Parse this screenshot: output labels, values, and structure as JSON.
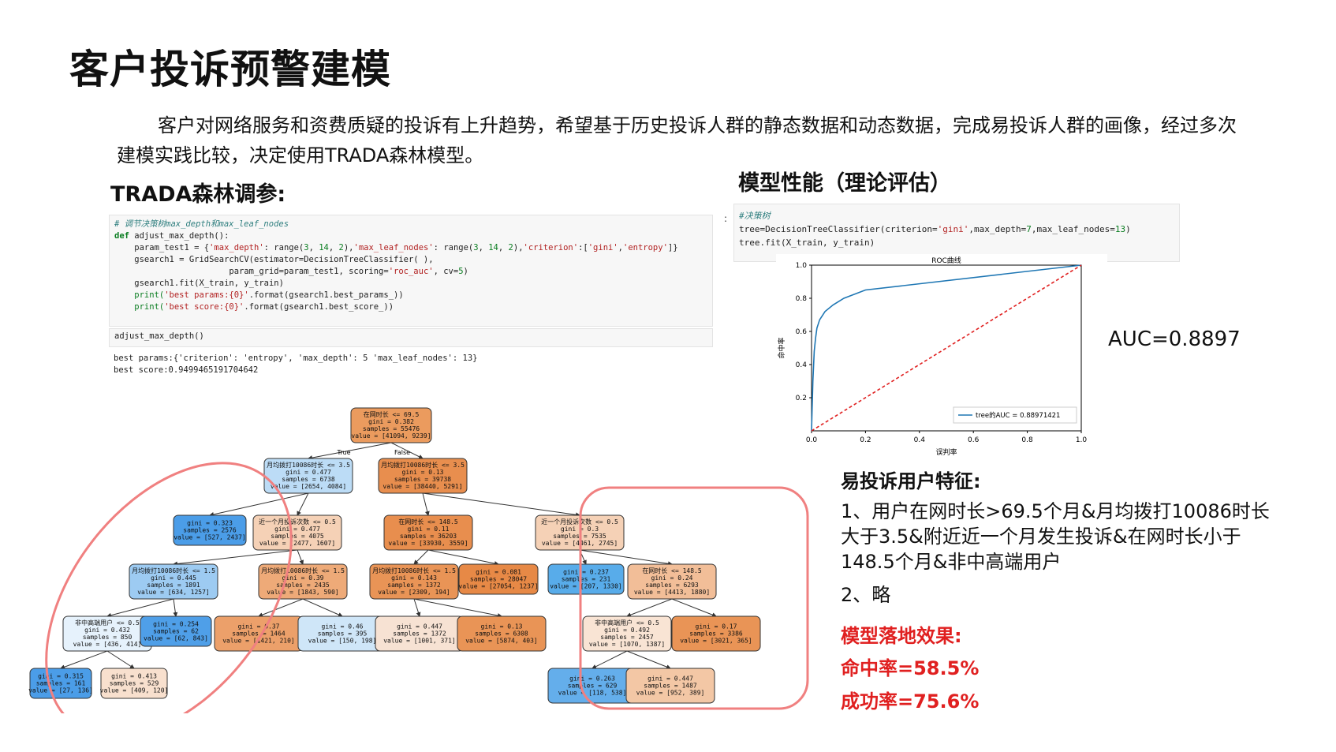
{
  "title": "客户投诉预警建模",
  "intro": "客户对网络服务和资费质疑的投诉有上升趋势，希望基于历史投诉人群的静态数据和动态数据，完成易投诉人群的画像，经过多次建模实践比较，决定使用TRADA森林模型。",
  "tuning": {
    "heading": "TRADA森林调参:",
    "code": {
      "line1": "# 调节决策树max_depth和max_leaf_nodes",
      "line2_kw": "def",
      "line2_rest": " adjust_max_depth():",
      "line3a": "    param_test1 = {",
      "line3b": "'max_depth'",
      "line3c": ": range(",
      "line3d": "3",
      "line3e": ", ",
      "line3f": "14",
      "line3g": ", ",
      "line3h": "2",
      "line3i": "),",
      "line3j": "'max_leaf_nodes'",
      "line3k": ": range(",
      "line3l": "3",
      "line3m": ", ",
      "line3n": "14",
      "line3o": ", ",
      "line3p": "2",
      "line3q": "),",
      "line3r": "'criterion'",
      "line3s": ":[",
      "line3t": "'gini'",
      "line3u": ",",
      "line3v": "'entropy'",
      "line3w": "]}",
      "line4": "    gsearch1 = GridSearchCV(estimator=DecisionTreeClassifier( ),",
      "line5a": "                       param_grid=param_test1, scoring=",
      "line5b": "'roc_auc'",
      "line5c": ", cv=",
      "line5d": "5",
      "line5e": ")",
      "line6": "    gsearch1.fit(X_train, y_train)",
      "line7a": "    print(",
      "line7b": "'best params:{0}'",
      "line7c": ".format(gsearch1.best_params_))",
      "line8a": "    print(",
      "line8b": "'best score:{0}'",
      "line8c": ".format(gsearch1.best_score_))"
    },
    "call": "adjust_max_depth()",
    "output1": "best params:{'criterion': 'entropy', 'max_depth': 5 'max_leaf_nodes': 13}",
    "output2": "best score:0.9499465191704642"
  },
  "performance": {
    "heading": "模型性能（理论评估）",
    "code_prompt": ":",
    "code_line1": "#决策树",
    "code_line2a": "tree=DecisionTreeClassifier(criterion=",
    "code_line2b": "'gini'",
    "code_line2c": ",max_depth=",
    "code_line2d": "7",
    "code_line2e": ",max_leaf_nodes=",
    "code_line2f": "13",
    "code_line2g": ")",
    "code_line3": "tree.fit(X_train, y_train)",
    "auc_text": "AUC=0.8897"
  },
  "chart_data": {
    "type": "line",
    "title": "ROC曲线",
    "xlabel": "误判率",
    "ylabel": "命中率",
    "xlim": [
      0,
      1.0
    ],
    "ylim": [
      0,
      1.0
    ],
    "xticks": [
      "0.0",
      "0.2",
      "0.4",
      "0.6",
      "0.8",
      "1.0"
    ],
    "yticks": [
      "0.2",
      "0.4",
      "0.6",
      "0.8",
      "1.0"
    ],
    "legend_position": "bottom-right",
    "series": [
      {
        "name": "tree的AUC = 0.88971421",
        "color": "#1f77b4",
        "x": [
          0.0,
          0.005,
          0.01,
          0.015,
          0.02,
          0.03,
          0.05,
          0.08,
          0.12,
          0.2,
          1.0
        ],
        "y": [
          0.0,
          0.3,
          0.48,
          0.56,
          0.62,
          0.67,
          0.72,
          0.76,
          0.8,
          0.85,
          1.0
        ]
      },
      {
        "name": "",
        "color": "#e02020",
        "x": [
          0.0,
          1.0
        ],
        "y": [
          0.0,
          1.0
        ]
      }
    ]
  },
  "features": {
    "heading": "易投诉用户特征:",
    "item1": "1、用户在网时长>69.5个月&月均拨打10086时长大于3.5&附近近一个月发生投诉&在网时长小于148.5个月&非中高端用户",
    "item2": "2、略"
  },
  "effect": {
    "heading": "模型落地效果:",
    "hit_rate": "命中率=58.5%",
    "success_rate": "成功率=75.6%"
  },
  "tree": {
    "true_label": "True",
    "false_label": "False",
    "nodes": [
      {
        "id": "n0",
        "l1": "在网时长 <= 69.5",
        "l2": "gini = 0.382",
        "l3": "samples = 55476",
        "l4": "value = [41094, 9239]",
        "color": "#eb9b5e"
      },
      {
        "id": "n1",
        "l1": "月均拨打10086时长 <= 3.5",
        "l2": "gini = 0.477",
        "l3": "samples = 6738",
        "l4": "value = [2654, 4084]",
        "color": "#bcdcf6"
      },
      {
        "id": "n2",
        "l1": "月均拨打10086时长 <= 3.5",
        "l2": "gini = 0.13",
        "l3": "samples = 39738",
        "l4": "value = [38440, 5291]",
        "color": "#e88e4e"
      },
      {
        "id": "n3",
        "l1": "",
        "l2": "gini = 0.323",
        "l3": "samples = 2576",
        "l4": "value = [527, 2437]",
        "color": "#4b9de8"
      },
      {
        "id": "n4",
        "l1": "近一个月投诉次数 <= 0.5",
        "l2": "gini = 0.477",
        "l3": "samples = 4075",
        "l4": "value = [2477, 1607]",
        "color": "#f5d1b6"
      },
      {
        "id": "n5",
        "l1": "在网时长 <= 148.5",
        "l2": "gini = 0.11",
        "l3": "samples = 36203",
        "l4": "value = [33930, 3559]",
        "color": "#e88e4e"
      },
      {
        "id": "n6",
        "l1": "近一个月投诉次数 <= 0.5",
        "l2": "gini = 0.3",
        "l3": "samples = 7535",
        "l4": "value = [4461, 2745]",
        "color": "#f5d1b6"
      },
      {
        "id": "n7",
        "l1": "月均拨打10086时长 <= 1.5",
        "l2": "gini = 0.445",
        "l3": "samples = 1891",
        "l4": "value = [634, 1257]",
        "color": "#9dcbf2"
      },
      {
        "id": "n8",
        "l1": "月均拨打10086时长 <= 1.5",
        "l2": "gini = 0.39",
        "l3": "samples = 2435",
        "l4": "value = [1843, 590]",
        "color": "#eeaa78"
      },
      {
        "id": "n9",
        "l1": "月均拨打10086时长 <= 1.5",
        "l2": "gini = 0.143",
        "l3": "samples = 1372",
        "l4": "value = [2309, 194]",
        "color": "#e99456"
      },
      {
        "id": "n10",
        "l1": "",
        "l2": "gini = 0.081",
        "l3": "samples = 28047",
        "l4": "value = [27054, 1237]",
        "color": "#e78946"
      },
      {
        "id": "n11",
        "l1": "",
        "l2": "gini = 0.237",
        "l3": "samples = 231",
        "l4": "value = [207, 1330]",
        "color": "#58acea"
      },
      {
        "id": "n12",
        "l1": "在网时长 <= 148.5",
        "l2": "gini = 0.24",
        "l3": "samples = 6293",
        "l4": "value = [4413, 1880]",
        "color": "#f2be98"
      },
      {
        "id": "n13",
        "l1": "非中高端用户 <= 0.5",
        "l2": "gini = 0.432",
        "l3": "samples = 850",
        "l4": "value = [436, 414]",
        "color": "#e6f2fc"
      },
      {
        "id": "n14",
        "l1": "",
        "l2": "gini = 0.254",
        "l3": "samples = 62",
        "l4": "value = [62, 843]",
        "color": "#4f9fe8"
      },
      {
        "id": "n15",
        "l1": "",
        "l2": "gini = 0.37",
        "l3": "samples = 1464",
        "l4": "value = [1421, 210]",
        "color": "#eca06a"
      },
      {
        "id": "n16",
        "l1": "",
        "l2": "gini = 0.46",
        "l3": "samples = 395",
        "l4": "value = [150, 198]",
        "color": "#cfe6f8"
      },
      {
        "id": "n17",
        "l1": "",
        "l2": "gini = 0.447",
        "l3": "samples = 1372",
        "l4": "value = [1001, 371]",
        "color": "#f7e2d3"
      },
      {
        "id": "n18",
        "l1": "",
        "l2": "gini = 0.13",
        "l3": "samples = 6308",
        "l4": "value = [5874, 403]",
        "color": "#e99456"
      },
      {
        "id": "n19",
        "l1": "非中高端用户 <= 0.5",
        "l2": "gini = 0.492",
        "l3": "samples = 2457",
        "l4": "value = [1070, 1387]",
        "color": "#f9e4d4"
      },
      {
        "id": "n20",
        "l1": "",
        "l2": "gini = 0.17",
        "l3": "samples = 3386",
        "l4": "value = [3021, 365]",
        "color": "#e99456"
      },
      {
        "id": "n21",
        "l1": "",
        "l2": "gini = 0.315",
        "l3": "samples = 161",
        "l4": "value = [27, 136]",
        "color": "#4b9de8"
      },
      {
        "id": "n22",
        "l1": "",
        "l2": "gini = 0.413",
        "l3": "samples = 529",
        "l4": "value = [409, 120]",
        "color": "#f8e0ce"
      },
      {
        "id": "n23",
        "l1": "",
        "l2": "gini = 0.263",
        "l3": "samples = 629",
        "l4": "value = [118, 538]",
        "color": "#64aeeb"
      },
      {
        "id": "n24",
        "l1": "",
        "l2": "gini = 0.447",
        "l3": "samples = 1487",
        "l4": "value = [952, 389]",
        "color": "#f3c7a5"
      }
    ]
  }
}
